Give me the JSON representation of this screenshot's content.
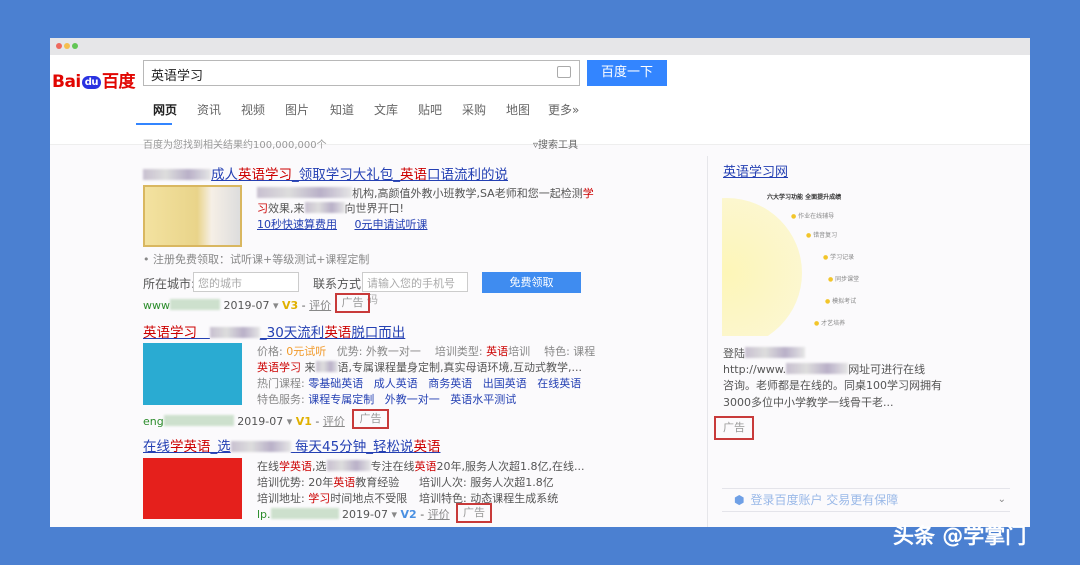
{
  "search": {
    "query": "英语学习",
    "button": "百度一下"
  },
  "logo": {
    "text_a": "Bai",
    "text_paw": "du",
    "text_b": "百度"
  },
  "tabs": [
    "网页",
    "资讯",
    "视频",
    "图片",
    "知道",
    "文库",
    "贴吧",
    "采购",
    "地图",
    "更多»"
  ],
  "result_count": "百度为您找到相关结果约100,000,000个",
  "search_tools": "搜索工具",
  "r1": {
    "t1": "成人",
    "t2": "英语学习",
    "t3": "_领取学习大礼包_",
    "t4": "英语",
    "t5": "口语流利的说",
    "d1": "机构,高颜值外教小班教学,SA老师和您一起检测",
    "d1r": "学",
    "d2r": "习",
    "d2": "效果,来",
    "d2b": "向世界开口!",
    "link1": "10秒快速算费用",
    "link2": "0元申请试听课",
    "signup": "• 注册免费领取：试听课+等级测试+课程定制",
    "city_label": "所在城市:",
    "city_placeholder": "您的城市",
    "contact_label": "联系方式:",
    "contact_placeholder": "请输入您的手机号码",
    "submit": "免费领取",
    "url": "www",
    "date": "2019-07",
    "vbadge": "V3",
    "review": "评价",
    "ad": "广告"
  },
  "r2": {
    "t1": "英语学习",
    "t2": "_30天流利",
    "t3": "英语",
    "t4": "脱口而出",
    "l1a": "价格: ",
    "l1b": "0元试听",
    "l1c": "   优势: 外教一对一    培训类型: ",
    "l1d": "英语",
    "l1e": "培训    特色: 课程",
    "l2a": "英语学习",
    "l2b": " 来",
    "l2c": "语,专属课程量身定制,真实母语环境,互动式教学,...",
    "l3a": "热门课程: ",
    "hot": [
      "零基础英语",
      "成人英语",
      "商务英语",
      "出国英语",
      "在线英语"
    ],
    "l4a": "特色服务: ",
    "svc": [
      "课程专属定制",
      "外教一对一",
      "英语水平测试"
    ],
    "url": "eng",
    "date": "2019-07",
    "vbadge": "V1",
    "review": "评价",
    "ad": "广告"
  },
  "r3": {
    "t1": "在线",
    "t2": "学英语",
    "t3": "_选",
    "t4": "每天45分钟_轻松说",
    "t5": "英语",
    "l1a": "在线",
    "l1b": "学英语",
    "l1c": ",选",
    "l1d": "专注在线",
    "l1e": "英语",
    "l1f": "20年,服务人次超1.8亿,在线...",
    "l2a": "培训优势: 20年",
    "l2b": "英语",
    "l2c": "教育经验",
    "l2d": "培训人次: 服务人次超1.8亿",
    "l3a": "培训地址: ",
    "l3b": "学习",
    "l3c": "时间地点不受限",
    "l3d": "培训特色: 动态课程生成系统",
    "url": "lp.",
    "date": "2019-07",
    "vbadge": "V2",
    "review": "评价",
    "ad": "广告"
  },
  "side": {
    "title": "英语学习网",
    "img_title": "六大学习功能 全面提升成绩",
    "img_items": [
      "作业在线辅导",
      "错音复习",
      "学习记录",
      "同步课堂",
      "模拟考试",
      "才艺培养"
    ],
    "l1": "登陆",
    "l2a": "http://www.",
    "l2b": "网址可进行在线",
    "l3": "咨询。老师都是在线的。同桌100学习网拥有",
    "l4": "3000多位中小学教学一线骨干老...",
    "ad": "广告",
    "login": "登录百度账户 交易更有保障"
  },
  "watermark": "头条 @学掌门"
}
